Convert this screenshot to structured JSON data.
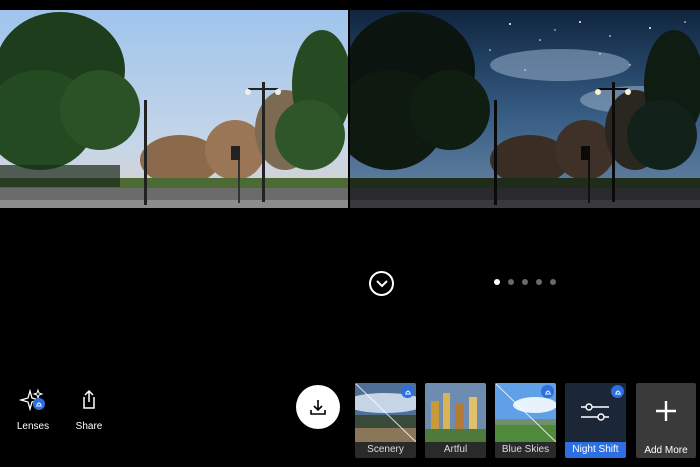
{
  "toolbar": {
    "lenses_label": "Lenses",
    "share_label": "Share"
  },
  "pagination": {
    "total": 5,
    "active_index": 0
  },
  "lenses": [
    {
      "label": "Scenery",
      "premium": true,
      "selected": false
    },
    {
      "label": "Artful",
      "premium": false,
      "selected": false
    },
    {
      "label": "Blue Skies",
      "premium": true,
      "selected": false
    },
    {
      "label": "Night Shift",
      "premium": true,
      "selected": true
    }
  ],
  "add_more_label": "Add More",
  "colors": {
    "accent": "#2d6fe0",
    "background": "#000000"
  },
  "icons": {
    "lenses": "sparkle-icon",
    "share": "share-icon",
    "download": "download-icon",
    "collapse": "chevron-down-icon",
    "add": "plus-icon",
    "premium": "cloud-badge-icon"
  }
}
